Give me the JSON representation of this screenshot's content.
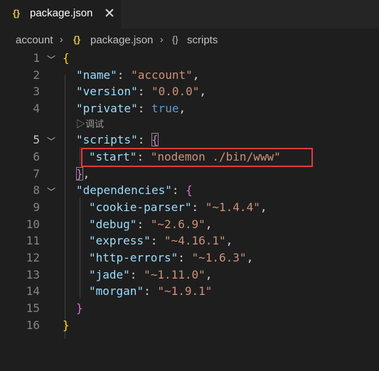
{
  "tab": {
    "icon": "{}",
    "title": "package.json",
    "close": "✕"
  },
  "breadcrumb": {
    "folder": "account",
    "file": "package.json",
    "section_icon": "{}",
    "section": "scripts"
  },
  "code_lens": "▷调试",
  "line_numbers": [
    "1",
    "2",
    "3",
    "4",
    "5",
    "6",
    "7",
    "8",
    "9",
    "10",
    "11",
    "12",
    "13",
    "14",
    "15",
    "16"
  ],
  "code": {
    "l1": {
      "open": "{"
    },
    "l2": {
      "key": "\"name\"",
      "colon": ": ",
      "value": "\"account\"",
      "comma": ","
    },
    "l3": {
      "key": "\"version\"",
      "colon": ": ",
      "value": "\"0.0.0\"",
      "comma": ","
    },
    "l4": {
      "key": "\"private\"",
      "colon": ": ",
      "value": "true",
      "comma": ","
    },
    "l5": {
      "key": "\"scripts\"",
      "colon": ": ",
      "open": "{"
    },
    "l6": {
      "key": "\"start\"",
      "colon": ": ",
      "value": "\"nodemon ./bin/www\""
    },
    "l7": {
      "close": "}",
      "comma": ","
    },
    "l8": {
      "key": "\"dependencies\"",
      "colon": ": ",
      "open": "{"
    },
    "l9": {
      "key": "\"cookie-parser\"",
      "colon": ": ",
      "value": "\"~1.4.4\"",
      "comma": ","
    },
    "l10": {
      "key": "\"debug\"",
      "colon": ": ",
      "value": "\"~2.6.9\"",
      "comma": ","
    },
    "l11": {
      "key": "\"express\"",
      "colon": ": ",
      "value": "\"~4.16.1\"",
      "comma": ","
    },
    "l12": {
      "key": "\"http-errors\"",
      "colon": ": ",
      "value": "\"~1.6.3\"",
      "comma": ","
    },
    "l13": {
      "key": "\"jade\"",
      "colon": ": ",
      "value": "\"~1.11.0\"",
      "comma": ","
    },
    "l14": {
      "key": "\"morgan\"",
      "colon": ": ",
      "value": "\"~1.9.1\""
    },
    "l15": {
      "close": "}"
    },
    "l16": {
      "close": "}"
    }
  },
  "colors": {
    "background": "#1e1e1e",
    "key": "#9cdcfe",
    "string": "#ce9178",
    "boolean": "#569cd6",
    "highlight_border": "#e03b3b"
  }
}
